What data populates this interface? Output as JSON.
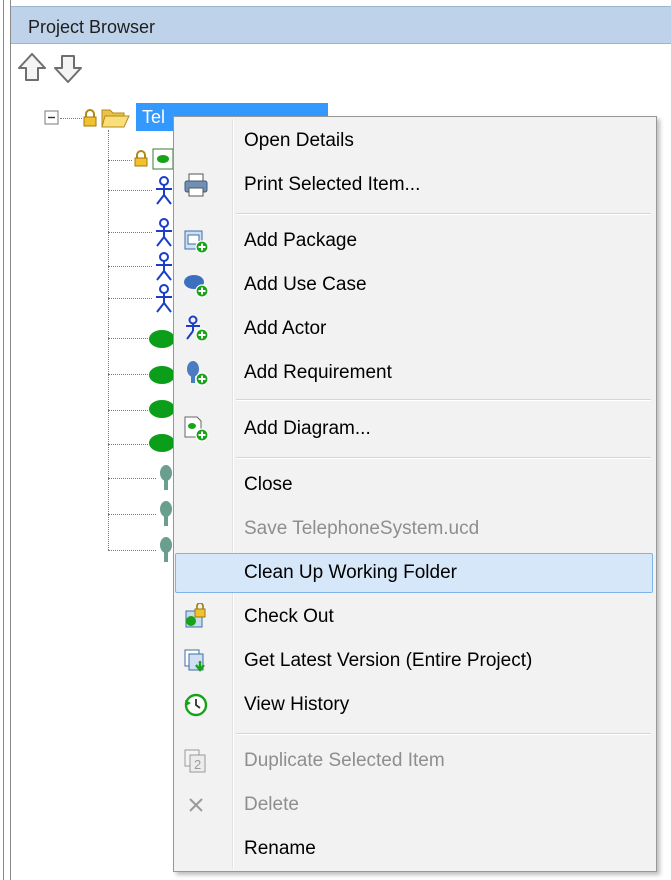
{
  "panel": {
    "title": "Project Browser",
    "toolbar": {
      "up_icon": "arrow-up-icon",
      "down_icon": "arrow-down-icon"
    }
  },
  "tree": {
    "root_label": "Tel",
    "root_icons": [
      "collapse-icon",
      "lock-icon",
      "folder-open-icon"
    ],
    "children": [
      {
        "icon": "actor-icon"
      },
      {
        "icon": "actor-icon"
      },
      {
        "icon": "actor-icon"
      },
      {
        "icon": "actor-icon"
      },
      {
        "icon": "use-case-icon"
      },
      {
        "icon": "use-case-icon"
      },
      {
        "icon": "use-case-icon"
      },
      {
        "icon": "use-case-icon"
      },
      {
        "icon": "requirement-icon"
      },
      {
        "icon": "requirement-icon"
      },
      {
        "icon": "requirement-icon"
      }
    ]
  },
  "menu": {
    "items": [
      {
        "label": "Open Details",
        "icon": "",
        "enabled": true
      },
      {
        "label": "Print Selected Item...",
        "icon": "printer-icon",
        "enabled": true
      },
      {
        "label": "Add Package",
        "icon": "add-package-icon",
        "enabled": true
      },
      {
        "label": "Add Use Case",
        "icon": "add-use-case-icon",
        "enabled": true
      },
      {
        "label": "Add Actor",
        "icon": "add-actor-icon",
        "enabled": true
      },
      {
        "label": "Add Requirement",
        "icon": "add-requirement-icon",
        "enabled": true
      },
      {
        "label": "Add Diagram...",
        "icon": "add-diagram-icon",
        "enabled": true
      },
      {
        "label": "Close",
        "icon": "",
        "enabled": true
      },
      {
        "label": "Save TelephoneSystem.ucd",
        "icon": "",
        "enabled": false
      },
      {
        "label": "Clean Up Working Folder",
        "icon": "",
        "enabled": true,
        "highlighted": true
      },
      {
        "label": "Check Out",
        "icon": "check-out-icon",
        "enabled": true
      },
      {
        "label": "Get Latest Version (Entire Project)",
        "icon": "get-latest-icon",
        "enabled": true
      },
      {
        "label": "View History",
        "icon": "view-history-icon",
        "enabled": true
      },
      {
        "label": "Duplicate Selected Item",
        "icon": "duplicate-icon",
        "enabled": false
      },
      {
        "label": "Delete",
        "icon": "delete-icon",
        "enabled": false
      },
      {
        "label": "Rename",
        "icon": "",
        "enabled": true
      }
    ]
  },
  "colors": {
    "title_bar": "#bed2ea",
    "selection": "#3399ff",
    "menu_highlight": "#cce4f7",
    "disabled_text": "#8e8e8e"
  }
}
